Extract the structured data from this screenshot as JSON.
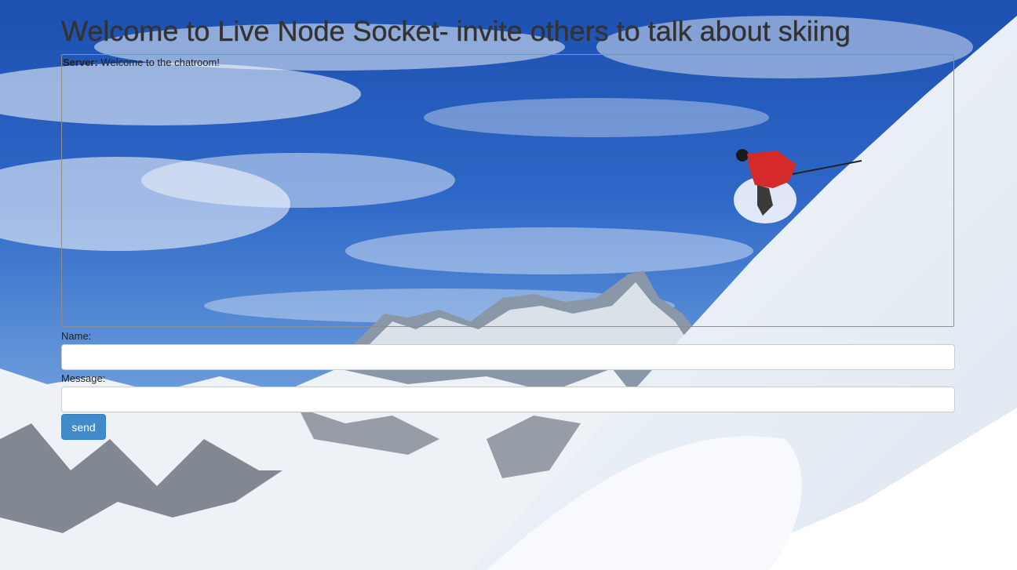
{
  "header": {
    "title": "Welcome to Live Node Socket- invite others to talk about skiing"
  },
  "chat": {
    "messages": [
      {
        "sender": "Server:",
        "text": " Welcome to the chatroom!"
      }
    ]
  },
  "form": {
    "name_label": "Name:",
    "name_value": "",
    "message_label": "Message:",
    "message_value": "",
    "send_label": "send"
  },
  "colors": {
    "button": "#428bca",
    "sky": "#2a63c4",
    "snow": "#ffffff"
  },
  "background": {
    "icon": "ski-mountain-photo"
  }
}
